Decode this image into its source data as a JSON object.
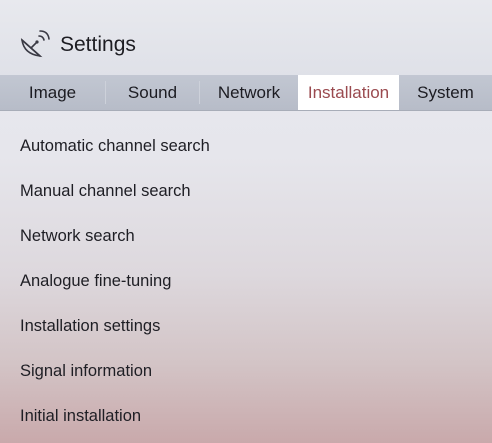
{
  "header": {
    "title": "Settings",
    "icon": "satellite-dish-icon"
  },
  "tabs": [
    {
      "label": "Image",
      "active": false
    },
    {
      "label": "Sound",
      "active": false
    },
    {
      "label": "Network",
      "active": false
    },
    {
      "label": "Installation",
      "active": true
    },
    {
      "label": "System",
      "active": false
    }
  ],
  "menu": {
    "items": [
      {
        "label": "Automatic channel search"
      },
      {
        "label": "Manual channel search"
      },
      {
        "label": "Network search"
      },
      {
        "label": "Analogue fine-tuning"
      },
      {
        "label": "Installation settings"
      },
      {
        "label": "Signal information"
      },
      {
        "label": "Initial installation"
      }
    ]
  },
  "colors": {
    "active_tab_text": "#9a4a4f",
    "active_tab_bg": "#ffffff",
    "tabbar_bg": "#bcc1cc"
  }
}
